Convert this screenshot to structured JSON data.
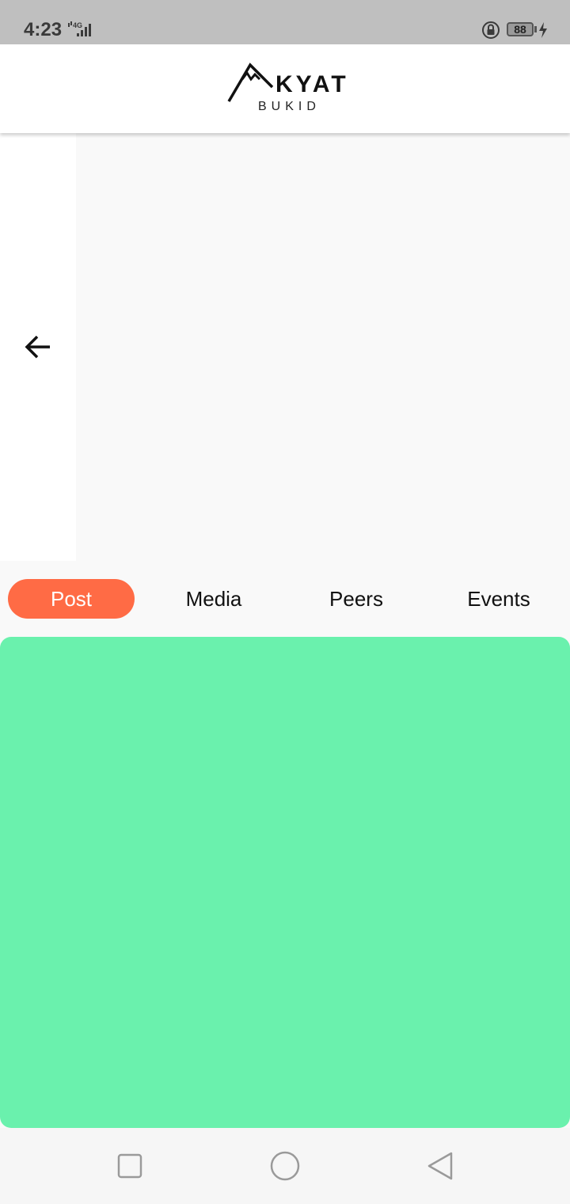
{
  "status_bar": {
    "time": "4:23",
    "network": "4G",
    "battery_level": "88"
  },
  "header": {
    "logo_word": "KYAT",
    "logo_subtitle": "BUKID",
    "logo_icon": "mountain-icon"
  },
  "side_panel": {
    "back_icon": "arrow-left-icon"
  },
  "tabs": [
    {
      "label": "Post",
      "active": true
    },
    {
      "label": "Media",
      "active": false
    },
    {
      "label": "Peers",
      "active": false
    },
    {
      "label": "Events",
      "active": false
    }
  ],
  "colors": {
    "accent": "#ff6b45",
    "content_card": "#6af1ad",
    "status_bar": "#bfbfbf"
  },
  "nav_bar": {
    "recents_icon": "square-icon",
    "home_icon": "circle-icon",
    "back_icon": "triangle-back-icon"
  }
}
